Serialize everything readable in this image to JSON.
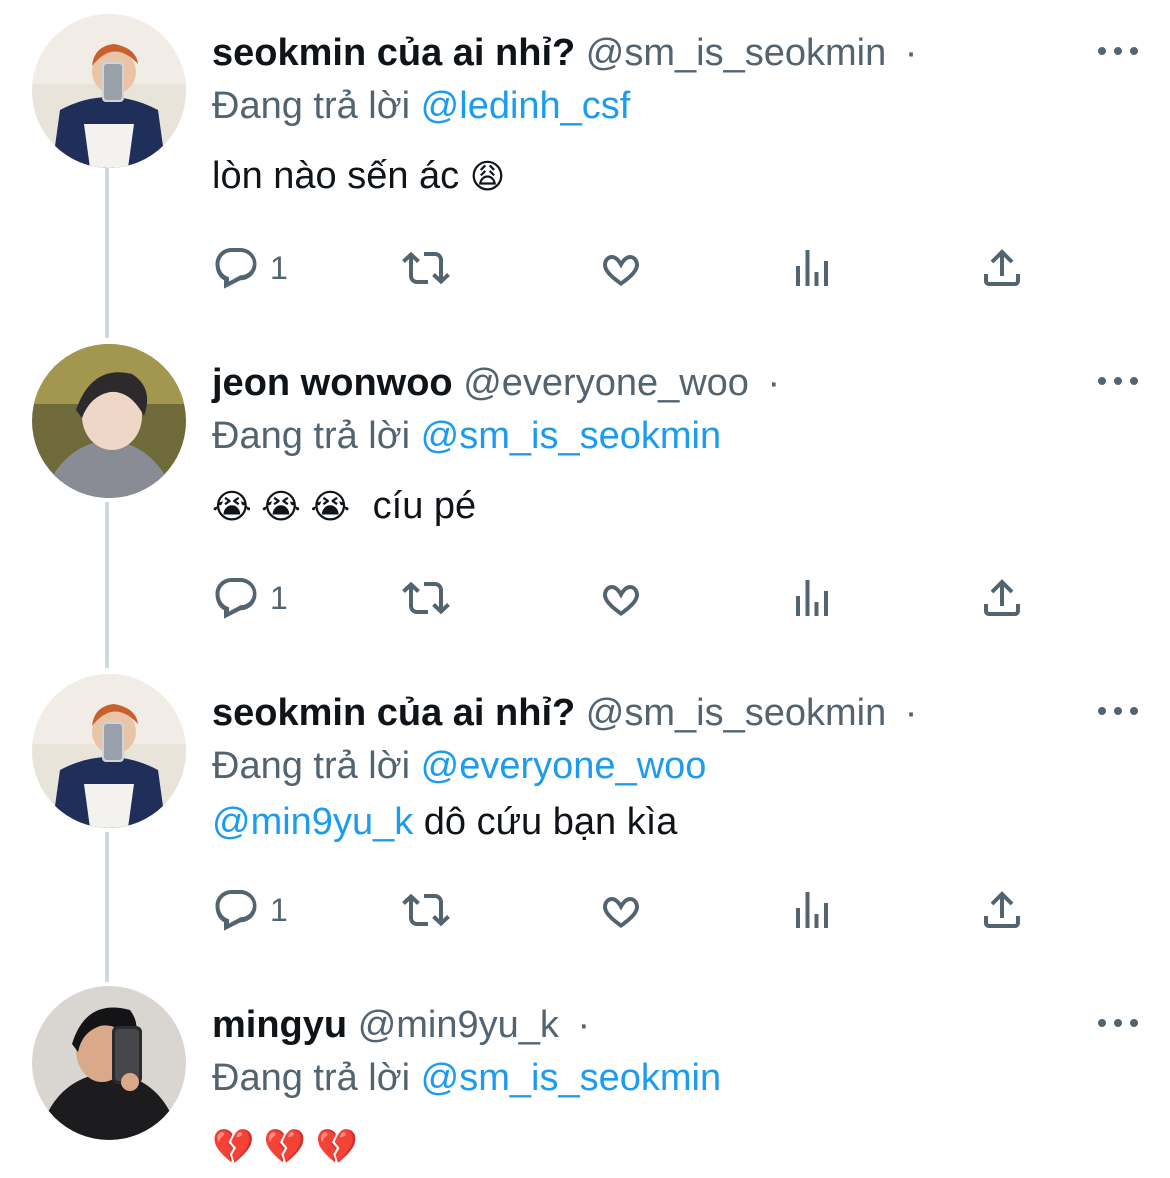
{
  "colors": {
    "link": "#1d9bf0",
    "muted": "#536471",
    "text": "#0f1419",
    "thread_line": "#cfd9de"
  },
  "tweets": [
    {
      "display_name": "seokmin của ai nhỉ?",
      "handle": "@sm_is_seokmin",
      "dot": "·",
      "reply_prefix": "Đang trả lời",
      "reply_to": "@ledinh_csf",
      "text": "lòn nào sến ác",
      "emoji": "😩",
      "reply_count": "1"
    },
    {
      "display_name": "jeon wonwoo",
      "handle": "@everyone_woo",
      "dot": "·",
      "reply_prefix": "Đang trả lời",
      "reply_to": "@sm_is_seokmin",
      "emoji": "😭 😭 😭",
      "text": "cíu pé",
      "reply_count": "1"
    },
    {
      "display_name": "seokmin của ai nhỉ?",
      "handle": "@sm_is_seokmin",
      "dot": "·",
      "reply_prefix": "Đang trả lời",
      "reply_to": "@everyone_woo",
      "mention": "@min9yu_k",
      "text": "dô cứu bạn kìa",
      "reply_count": "1"
    },
    {
      "display_name": "mingyu",
      "handle": "@min9yu_k",
      "dot": "·",
      "reply_prefix": "Đang trả lời",
      "reply_to": "@sm_is_seokmin",
      "emoji": "💔 💔 💔"
    }
  ],
  "icons": {
    "reply": "reply-icon",
    "retweet": "retweet-icon",
    "like": "heart-icon",
    "views": "analytics-icon",
    "share": "share-icon",
    "more": "more-icon"
  }
}
